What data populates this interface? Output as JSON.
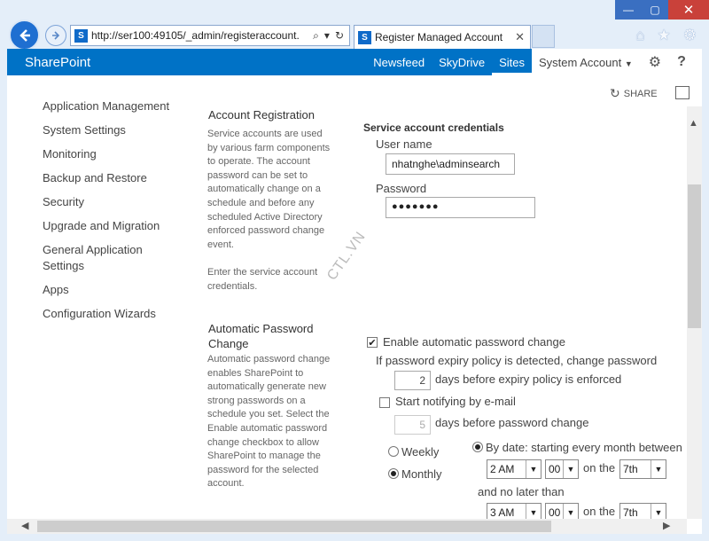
{
  "browser": {
    "address": "http://ser100:49105/_admin/registeraccount.",
    "tab_title": "Register Managed Account",
    "sp_letter": "S"
  },
  "suitebar": {
    "brand": "SharePoint",
    "links": [
      "Newsfeed",
      "SkyDrive",
      "Sites"
    ],
    "account": "System Account",
    "help": "?"
  },
  "page": {
    "share_label": "SHARE"
  },
  "leftnav": {
    "items": [
      "Application Management",
      "System Settings",
      "Monitoring",
      "Backup and Restore",
      "Security",
      "Upgrade and Migration",
      "General Application Settings",
      "Apps",
      "Configuration Wizards"
    ]
  },
  "registration": {
    "heading": "Account Registration",
    "desc1": "Service accounts are used by various farm components to operate. The account password can be set to automatically change on a schedule and before any scheduled Active Directory enforced password change event.",
    "desc2": "Enter the service account credentials."
  },
  "autochange": {
    "heading": "Automatic Password Change",
    "desc": "Automatic password change enables SharePoint to automatically generate new strong passwords on a schedule you set. Select the Enable automatic password change checkbox to allow SharePoint to manage the password for the selected account."
  },
  "form": {
    "title": "Service account credentials",
    "username_label": "User name",
    "username_value": "nhatnghe\\adminsearch",
    "password_label": "Password",
    "password_value": "●●●●●●●",
    "enable_label": "Enable automatic password change",
    "enable_checked": true,
    "expiry_text": "If password expiry policy is detected, change password",
    "days_before_expiry": "2",
    "days_before_expiry_text": "days before expiry policy is enforced",
    "notify_label": "Start notifying by e-mail",
    "notify_days": "5",
    "notify_days_text": "days before password change",
    "weekly_label": "Weekly",
    "monthly_label": "Monthly",
    "bydate_label": "By date: starting every month between",
    "start_hour": "2 AM",
    "start_min": "00",
    "on_the": "on the",
    "start_day": "7th",
    "no_later_than": "and no later than",
    "end_hour": "3 AM",
    "end_min": "00",
    "end_day": "7th"
  },
  "watermark": "CTL.VN",
  "colors": {
    "suitebar": "#0072c6",
    "back_button": "#1f6fd1",
    "close_button": "#c9413a"
  }
}
